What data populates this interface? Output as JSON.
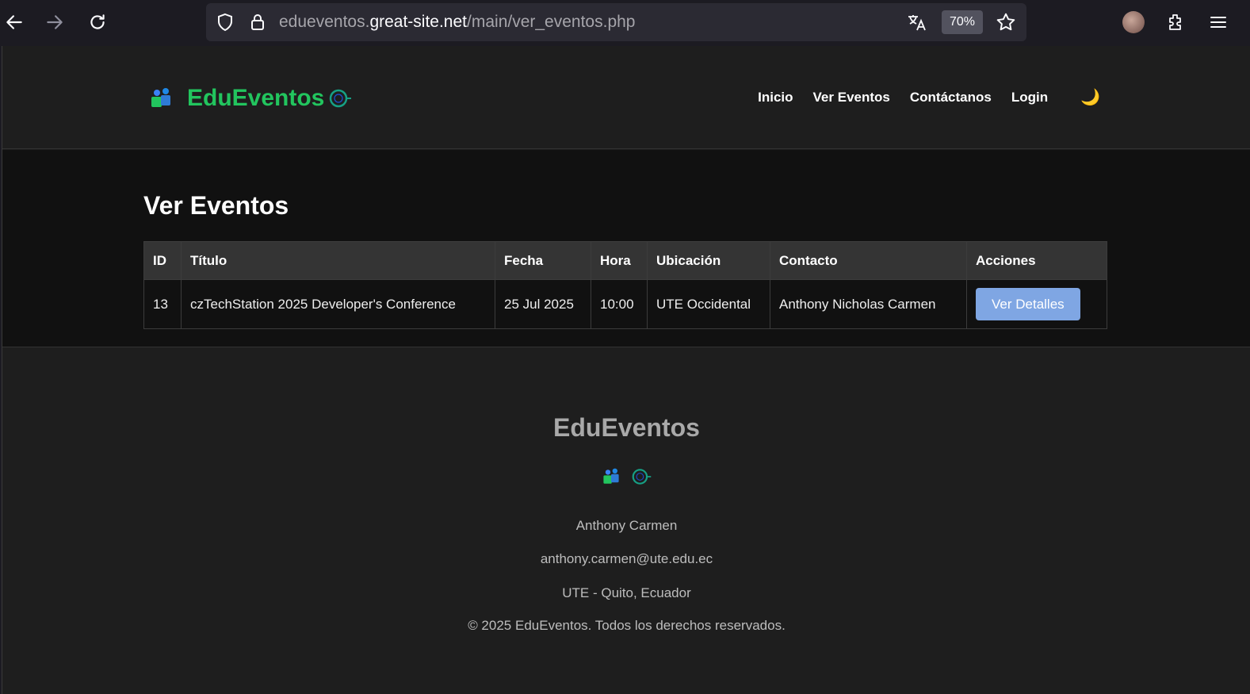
{
  "browser": {
    "url_prefix": "edueventos.",
    "url_domain": "great-site.net",
    "url_path": "/main/ver_eventos.php",
    "zoom": "70%"
  },
  "header": {
    "brand": "EduEventos",
    "nav": [
      "Inicio",
      "Ver Eventos",
      "Contáctanos",
      "Login"
    ]
  },
  "main": {
    "title": "Ver Eventos",
    "table": {
      "columns": [
        "ID",
        "Título",
        "Fecha",
        "Hora",
        "Ubicación",
        "Contacto",
        "Acciones"
      ],
      "rows": [
        {
          "id": "13",
          "titulo": "czTechStation 2025 Developer's Conference",
          "fecha": "25 Jul 2025",
          "hora": "10:00",
          "ubicacion": "UTE Occidental",
          "contacto": "Anthony Nicholas Carmen",
          "accion": "Ver Detalles"
        }
      ]
    }
  },
  "footer": {
    "title": "EduEventos",
    "name": "Anthony Carmen",
    "email": "anthony.carmen@ute.edu.ec",
    "location": "UTE - Quito, Ecuador",
    "copyright": "© 2025 EduEventos. Todos los derechos reservados."
  },
  "colors": {
    "brand": "#22c55e",
    "button": "#7fa6e3"
  }
}
